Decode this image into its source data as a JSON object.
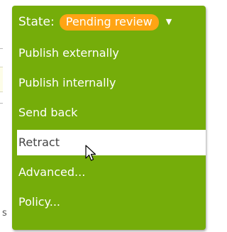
{
  "background": {
    "edge_letter": "s"
  },
  "workflow_menu": {
    "state_label": "State:",
    "state_value": "Pending review",
    "items": [
      {
        "label": "Publish externally"
      },
      {
        "label": "Publish internally"
      },
      {
        "label": "Send back"
      },
      {
        "label": "Retract"
      },
      {
        "label": "Advanced..."
      },
      {
        "label": "Policy..."
      }
    ],
    "hovered_item": "Retract"
  },
  "colors": {
    "menu_background": "#75ad0a",
    "state_badge": "#ffa414",
    "hover_background": "#ffffff",
    "text": "#ffffff"
  },
  "icons": [
    "caret-down-icon",
    "mouse-pointer-icon"
  ]
}
